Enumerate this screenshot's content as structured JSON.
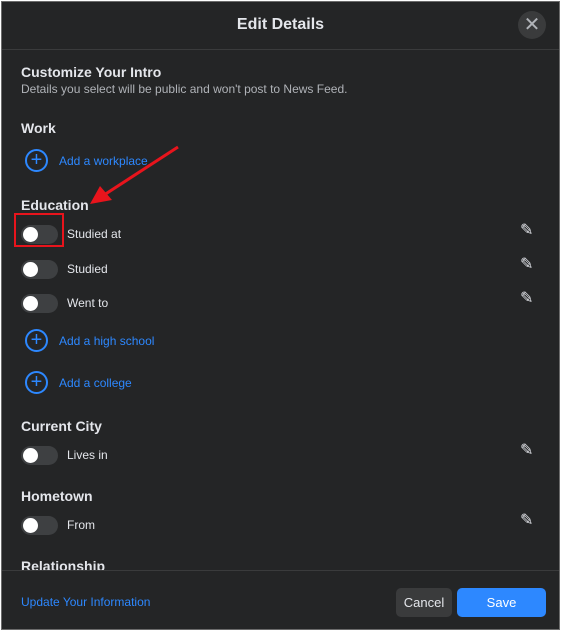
{
  "header": {
    "title": "Edit Details",
    "close_icon": "close-icon"
  },
  "intro": {
    "title": "Customize Your Intro",
    "subtitle": "Details you select will be public and won't post to News Feed."
  },
  "work": {
    "heading": "Work",
    "add_label": "Add a workplace"
  },
  "education": {
    "heading": "Education",
    "items": [
      {
        "label": "Studied at",
        "enabled": false
      },
      {
        "label": "Studied",
        "enabled": false
      },
      {
        "label": "Went to",
        "enabled": false
      }
    ],
    "add_high_school": "Add a high school",
    "add_college": "Add a college"
  },
  "current_city": {
    "heading": "Current City",
    "item": {
      "label": "Lives in",
      "enabled": false
    }
  },
  "hometown": {
    "heading": "Hometown",
    "item": {
      "label": "From",
      "enabled": false
    }
  },
  "relationship": {
    "heading": "Relationship"
  },
  "footer": {
    "update_link": "Update Your Information",
    "cancel": "Cancel",
    "save": "Save"
  },
  "colors": {
    "accent": "#2d88ff",
    "background": "#242526",
    "annotation": "#e8141c"
  }
}
